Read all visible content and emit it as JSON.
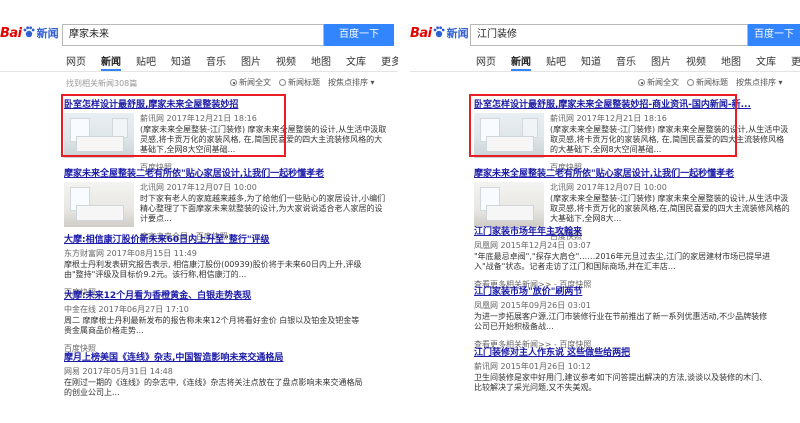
{
  "left": {
    "logo": {
      "text_a": "Bai",
      "text_b": "新闻"
    },
    "search": {
      "value": "摩家未来",
      "button": "百度一下"
    },
    "tabs": [
      "网页",
      "新闻",
      "贴吧",
      "知道",
      "音乐",
      "图片",
      "视频",
      "地图",
      "文库",
      "更多»"
    ],
    "meta": "找到相关新闻308篇",
    "options": {
      "full": "新闻全文",
      "title": "新闻标题",
      "sort": "按焦点排序"
    },
    "results": [
      {
        "title": "卧室怎样设计最舒服,摩家未来全屋整装妙招",
        "source": "薪讯网  2017年12月21日 18:16",
        "snippet": "(摩家未来全屋整装-江门装修) 摩家未来全屋整装的设计,从生活中汲取灵感,将卡贡万化的家装风格, 在,简国民喜爱的四大主流装修风格的大基础下,全网8大空间基础...",
        "cache": "百度快照"
      },
      {
        "title": "摩家未来全屋整装二老有所依\"贴心家居设计,让我们一起秒懂孝老",
        "source": "北讯网  2017年12月07日 10:00",
        "snippet": "时下家有老人的家庭越来越多,为了给他们一些贴心的家居设计,小编们精心整理了下面摩家未来就整装的设计,为大家说说适合老人家居的设计要点...",
        "cache": "摩家未来全屋 | 百度快照"
      },
      {
        "title": "大摩:相信康汀股价新未来60日内上升至\"整行\"评级",
        "source": "东方财富网  2017年08月15日 11:49",
        "snippet": "摩根士丹利发表研究报告表示, 相信康汀股份(00939)股价将于未来60日内上升,评级由\"整持\"评级及目标价9.2元。该行称,相信康汀的...",
        "cache": "百度快照"
      },
      {
        "title": "大摩:未来12个月看为香橙黄金、白银走势表现",
        "source": "中金在线  2017年06月27日 17:10",
        "snippet": "周二 摩摩根士丹利最新发布的报告称未来12个月将看好金价 白银以及铂金及钯金等贵金属商品价格走势...",
        "cache": "百度快照"
      },
      {
        "title": "摩月上榜美国《连线》杂志,中国智造影响未来交通格局",
        "source": "网易  2017年05月31日 14:48",
        "snippet": "在刚过一期的《连线》的杂志中,《连线》杂志将关注点放在了盘点影响未来交通格局的创业公司上...",
        "cache": ""
      }
    ]
  },
  "right": {
    "logo": {
      "text_a": "Bai",
      "text_b": "新闻"
    },
    "search": {
      "value": "江门装修",
      "button": "百度一下"
    },
    "tabs": [
      "网页",
      "新闻",
      "贴吧",
      "知道",
      "音乐",
      "图片",
      "视频",
      "地图",
      "文库",
      "更多»"
    ],
    "options": {
      "full": "新闻全文",
      "title": "新闻标题",
      "sort": "按焦点排序"
    },
    "results": [
      {
        "title": "卧室怎样设计最舒服,摩家未来全屋整装妙招-商业资讯-国内新闻-新...",
        "source": "薪讯网  2017年12月21日 18:16",
        "snippet": "(摩家未来全屋整装-江门装修) 摩家未来全屋整装的设计,从生活中汲取灵感,将卡贡万化的家装风格, 在,简国民喜爱的四大主流装修风格的大基础下,全网8大空间基础...",
        "cache": "百度快照"
      },
      {
        "title": "摩家未来全屋整装二老有所依\"贴心家居设计,让我们一起秒懂孝老",
        "source": "北讯网  2017年12月07日 10:00",
        "snippet": "(摩家未来全屋整装-江门装修) 摩家未来全屋整装的设计,从生活中汲取灵感,将卡贡万化的家装风格,在,简国民喜爱的四大主流装修风格的大基础下,全网8大...",
        "cache": "百度快照"
      },
      {
        "title": "江门家装市场年年主攻翰来",
        "source": "凤凰网  2015年12月24日 03:07",
        "snippet": "\"年底最忌卓阀\",\"探存大肩仓\"……2016年元旦过去尘,江门的家居建材市场已提早进入\"战备\"状态。记者走访了江门和国际商场,并在汇丰店...",
        "cache": "查看更多相关新闻>>  - 百度快照"
      },
      {
        "title": "江门家装市场\"放价\"刷两节",
        "source": "凤凰网  2015年09月26日 03:01",
        "snippet": "为进一步拓展客户源,江门市装修行业在节前推出了新一系列优惠活动,不少品牌装修公司已开始积极备战...",
        "cache": "查看更多相关新闻>>  - 百度快照"
      },
      {
        "title": "江门装修对主人作东说 这些做些给两把",
        "source": "薪讯网  2015年01月26日 10:12",
        "snippet": "卫生间装修是家中好用门,建议参考如下问答提出解决的方法,谈谈以及装修的木门、比较解决了采光问题,又不失美观。",
        "cache": ""
      }
    ]
  }
}
